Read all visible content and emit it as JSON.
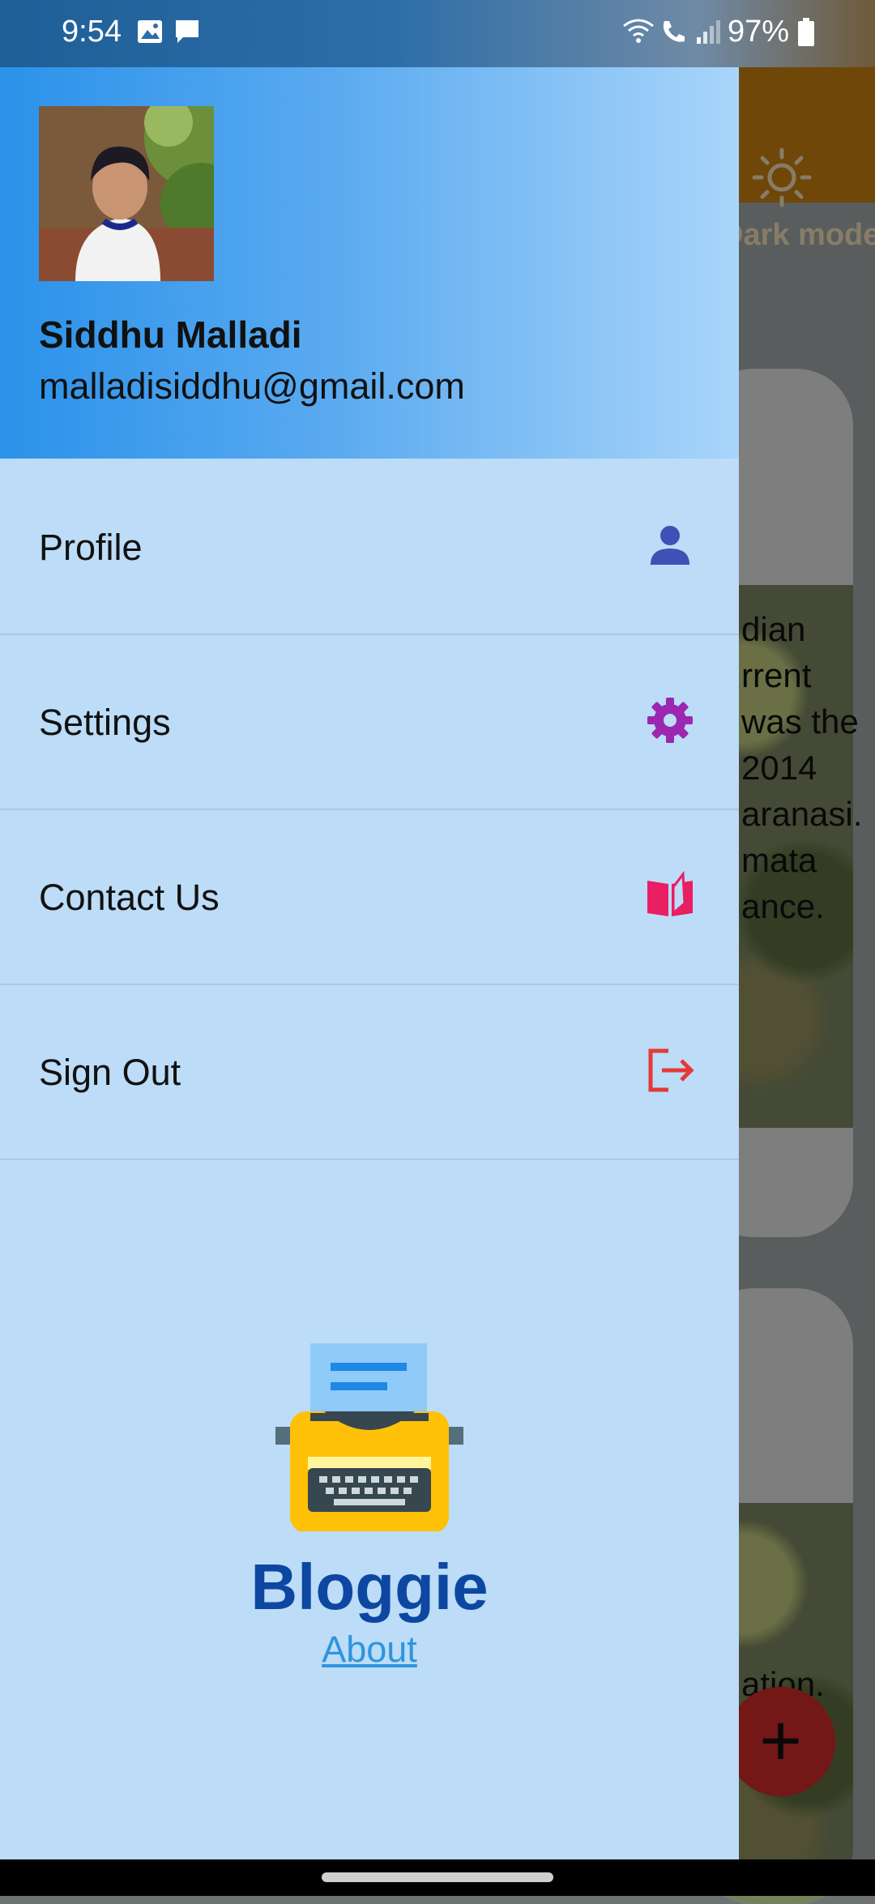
{
  "status_bar": {
    "time": "9:54",
    "battery": "97%",
    "icons": [
      "image-icon",
      "message-icon",
      "wifi-calling-icon",
      "volte-icon",
      "signal-icon",
      "battery-icon"
    ]
  },
  "background_app": {
    "dark_mode_label": "Dark mode",
    "card_text": "dian\nrrent\nwas the\n2014\naranasi.\nmata\nance.",
    "card2_text": "ation.",
    "fab_label": "+"
  },
  "drawer": {
    "user": {
      "name": "Siddhu Malladi",
      "email": "malladisiddhu@gmail.com"
    },
    "menu": [
      {
        "label": "Profile",
        "icon": "person-icon",
        "color": "#3f51b5"
      },
      {
        "label": "Settings",
        "icon": "gear-icon",
        "color": "#9c27b0"
      },
      {
        "label": "Contact Us",
        "icon": "open-book-icon",
        "color": "#e91e63"
      },
      {
        "label": "Sign Out",
        "icon": "sign-out-icon",
        "color": "#e53935"
      }
    ],
    "brand": {
      "name": "Bloggie",
      "about_link": "About",
      "logo_icon": "typewriter-icon"
    }
  },
  "colors": {
    "drawer_bg": "#bcdcf7",
    "brand_text": "#0d47a1",
    "link": "#2f95de",
    "header_gradient_start": "#2b92ea",
    "header_gradient_end": "#a9d5fa"
  }
}
